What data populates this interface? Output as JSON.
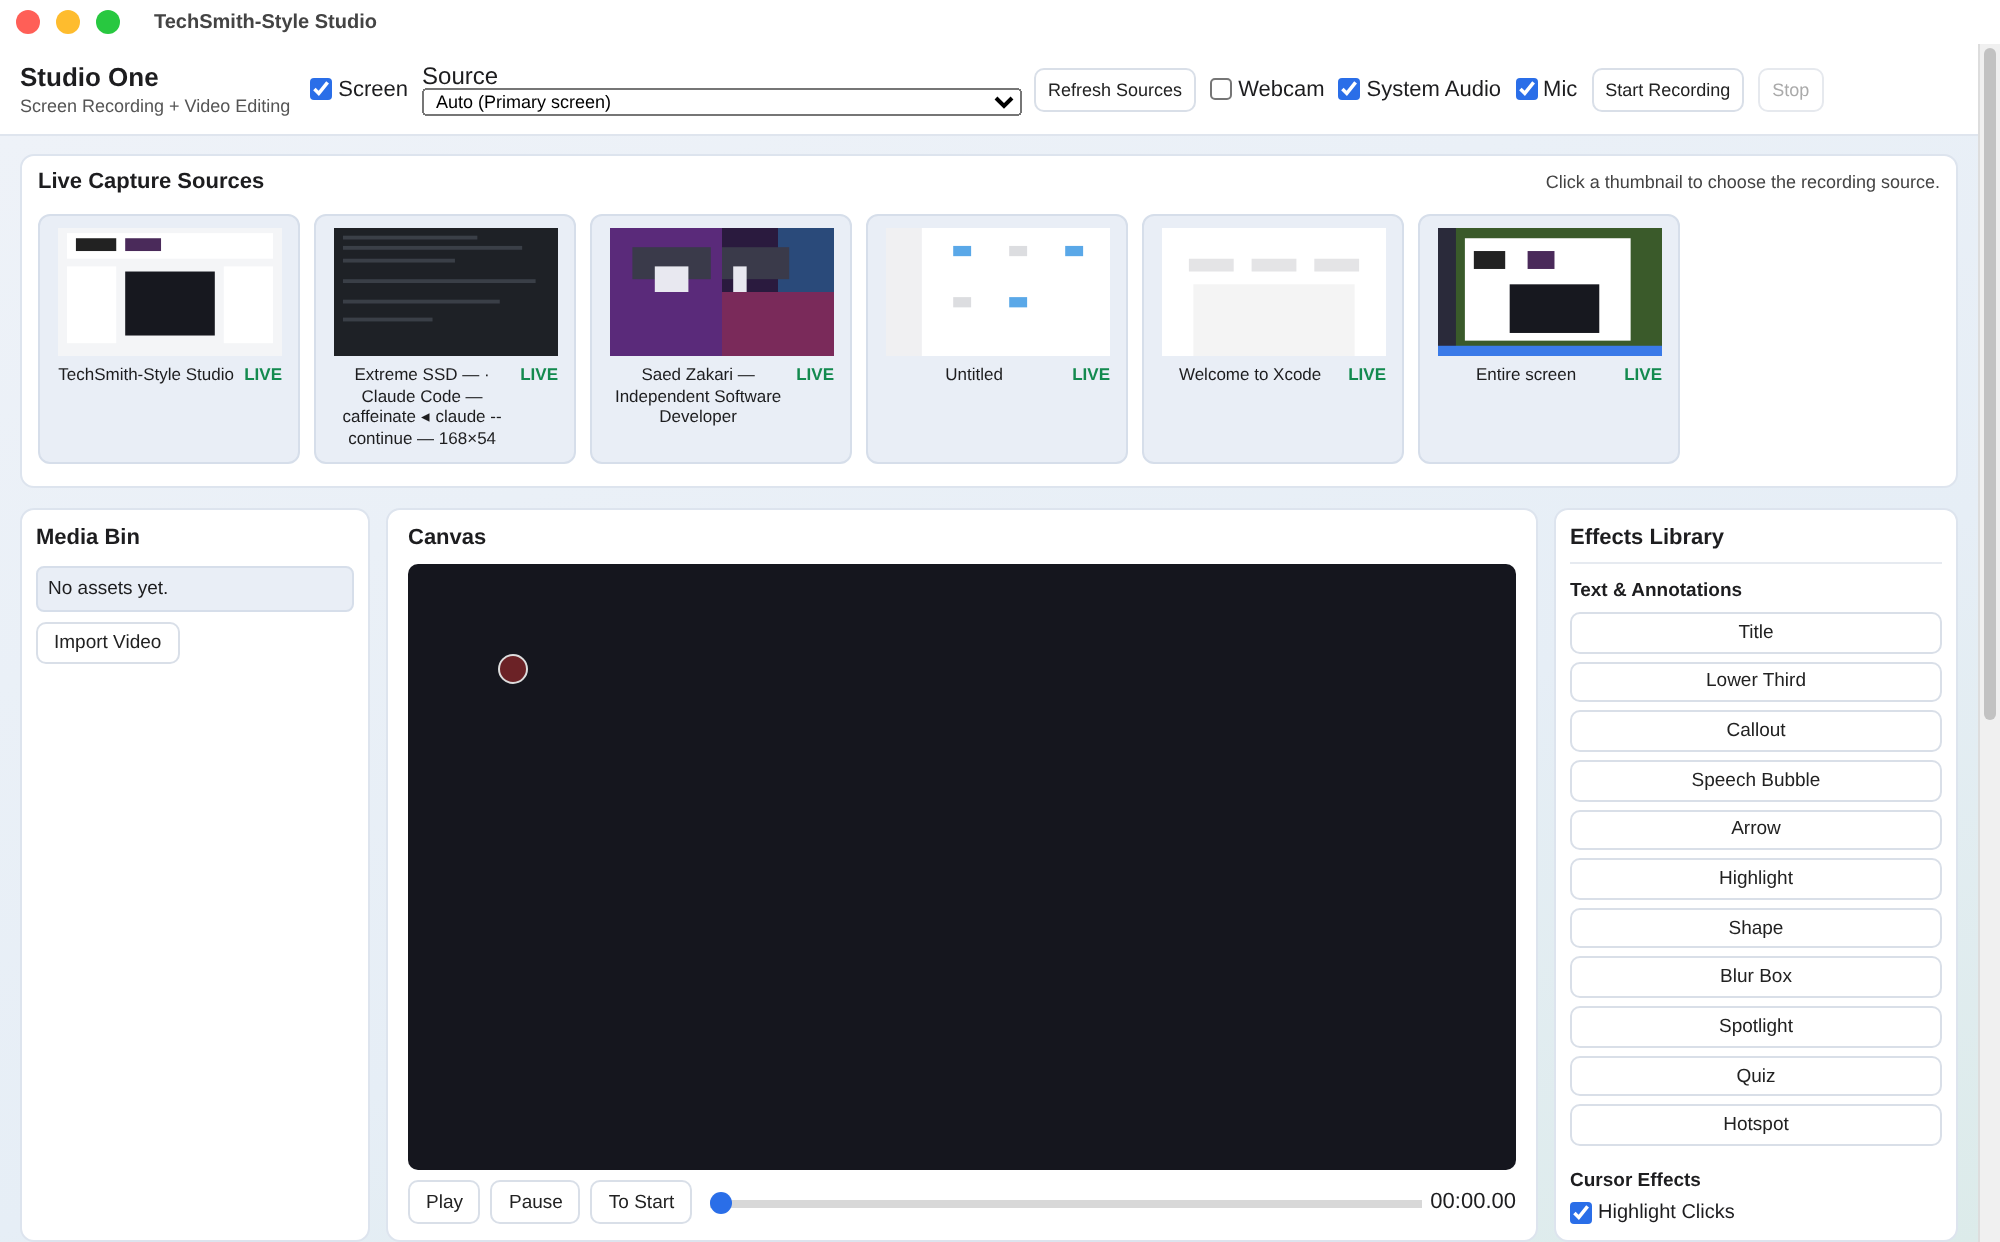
{
  "window": {
    "title": "TechSmith-Style Studio"
  },
  "header": {
    "app_name": "Studio One",
    "subtitle": "Screen Recording + Video Editing",
    "screen": {
      "label": "Screen",
      "checked": true
    },
    "source": {
      "label": "Source",
      "value": "Auto (Primary screen)"
    },
    "refresh_button": "Refresh Sources",
    "toggles": [
      {
        "label": "Webcam",
        "checked": false
      },
      {
        "label": "System Audio",
        "checked": true
      },
      {
        "label": "Mic",
        "checked": true
      }
    ],
    "buttons": [
      {
        "label": "Start Recording",
        "disabled": false
      },
      {
        "label": "Stop",
        "disabled": true
      }
    ]
  },
  "capture_sources": {
    "title": "Live Capture Sources",
    "hint": "Click a thumbnail to choose the recording source.",
    "items": [
      {
        "name": "TechSmith-Style Studio",
        "badge": "LIVE",
        "kind": "picture"
      },
      {
        "name": "Extreme SSD — · Claude Code — caffeinate ◂ claude --continue — 168×54",
        "badge": "LIVE",
        "kind": "picture"
      },
      {
        "name": "Saed Zakari — Independent Software Developer",
        "badge": "LIVE",
        "kind": "picture"
      },
      {
        "name": "Untitled",
        "badge": "LIVE",
        "kind": "picture"
      },
      {
        "name": "Welcome to Xcode",
        "badge": "LIVE",
        "kind": "picture"
      },
      {
        "name": "Entire screen",
        "badge": "LIVE",
        "kind": "picture"
      }
    ]
  },
  "media_bin": {
    "title": "Media Bin",
    "empty_text": "No assets yet.",
    "import_button": "Import Video"
  },
  "canvas": {
    "title": "Canvas",
    "controls": [
      "Play",
      "Pause",
      "To Start"
    ],
    "timeline": {
      "level": 0
    },
    "time": "00:00.00"
  },
  "effects_library": {
    "title": "Effects Library",
    "sections": [
      {
        "title": "Text & Annotations",
        "items": [
          {
            "kind": "button",
            "label": "Title"
          },
          {
            "kind": "button",
            "label": "Lower Third"
          },
          {
            "kind": "button",
            "label": "Callout"
          },
          {
            "kind": "button",
            "label": "Speech Bubble"
          },
          {
            "kind": "button",
            "label": "Arrow"
          },
          {
            "kind": "button",
            "label": "Highlight"
          },
          {
            "kind": "button",
            "label": "Shape"
          },
          {
            "kind": "button",
            "label": "Blur Box"
          },
          {
            "kind": "button",
            "label": "Spotlight"
          },
          {
            "kind": "button",
            "label": "Quiz"
          },
          {
            "kind": "button",
            "label": "Hotspot"
          }
        ]
      },
      {
        "title": "Cursor Effects",
        "items": [
          {
            "kind": "checkbox",
            "label": "Highlight Clicks",
            "checked": true
          }
        ]
      }
    ]
  }
}
